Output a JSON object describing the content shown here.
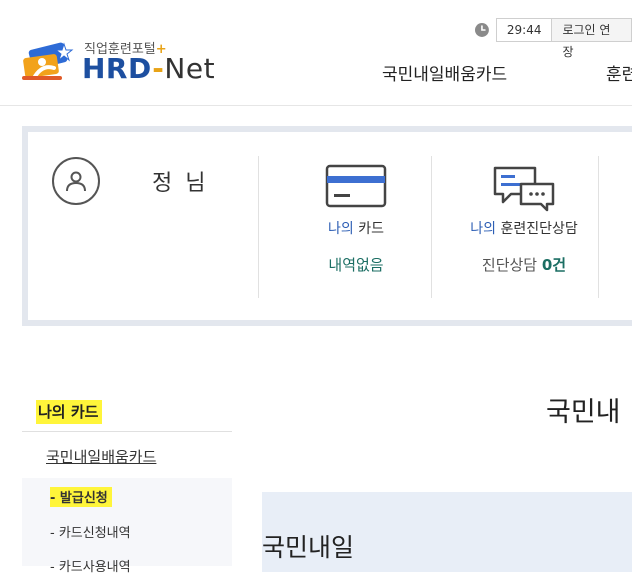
{
  "header": {
    "logo_sub": "직업훈련포털",
    "logo_plus": "+",
    "logo_hrd": "HRD",
    "logo_dash": "-",
    "logo_net": "Net",
    "timer": "29:44",
    "extend_login": "로그인 연장",
    "nav": [
      "국민내일배움카드",
      "훈련"
    ]
  },
  "user": {
    "name": "정 님"
  },
  "stats": [
    {
      "label_highlight": "나의",
      "label_rest": " 카드",
      "value": "내역없음"
    },
    {
      "label_highlight": "나의",
      "label_rest": " 훈련진단상담",
      "value_prefix": "진단상담 ",
      "value_num": "0건"
    }
  ],
  "sidebar": {
    "title": "나의 카드",
    "sub_title": "국민내일배움카드",
    "items": [
      "- 발급신청",
      "- 카드신청내역",
      "- 카드사용내역"
    ]
  },
  "main": {
    "title": "국민내",
    "box_title": "국민내일"
  },
  "colors": {
    "brand_blue": "#1d4fa0",
    "accent_orange": "#e8a317",
    "highlight_yellow": "#fff53a",
    "value_green": "#1b6e63",
    "label_blue": "#2e5fb5"
  }
}
